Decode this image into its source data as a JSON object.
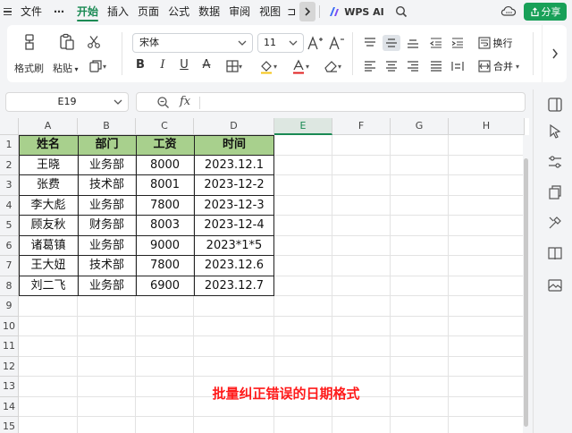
{
  "menubar": {
    "file": "文件",
    "dots": "⋯",
    "tabs": [
      "开始",
      "插入",
      "页面",
      "公式",
      "数据",
      "审阅",
      "视图"
    ],
    "overflow": "⊐",
    "wps_ai": "WPS AI",
    "share": "分享"
  },
  "ribbon": {
    "format_painter": "格式刷",
    "paste": "粘贴",
    "font_name": "宋体",
    "font_size": "11",
    "bold": "B",
    "italic": "I",
    "underline": "U",
    "strike": "A",
    "wrap": "换行",
    "merge": "合并"
  },
  "formula_bar": {
    "cell_ref": "E19",
    "fx": "fx",
    "formula": ""
  },
  "grid": {
    "columns": [
      "A",
      "B",
      "C",
      "D",
      "E",
      "F",
      "G",
      "H"
    ],
    "selected_column": "E",
    "rows": [
      "1",
      "2",
      "3",
      "4",
      "5",
      "6",
      "7",
      "8",
      "9",
      "10",
      "11",
      "12",
      "13",
      "14",
      "15"
    ]
  },
  "table": {
    "headers": [
      "姓名",
      "部门",
      "工资",
      "时间"
    ],
    "rows": [
      [
        "王晓",
        "业务部",
        "8000",
        "2023.12.1"
      ],
      [
        "张费",
        "技术部",
        "8001",
        "2023-12-2"
      ],
      [
        "李大彪",
        "业务部",
        "7800",
        "2023-12-3"
      ],
      [
        "顾友秋",
        "财务部",
        "8003",
        "2023-12-4"
      ],
      [
        "诸葛镇",
        "业务部",
        "9000",
        "2023*1*5"
      ],
      [
        "王大妞",
        "技术部",
        "7800",
        "2023.12.6"
      ],
      [
        "刘二飞",
        "业务部",
        "6900",
        "2023.12.7"
      ]
    ]
  },
  "annotation": "批量纠正错误的日期格式",
  "colors": {
    "accent": "#1a8a54",
    "header_fill": "#a8d08d",
    "annotation": "#ff1a1a",
    "share_button": "#18a058"
  }
}
